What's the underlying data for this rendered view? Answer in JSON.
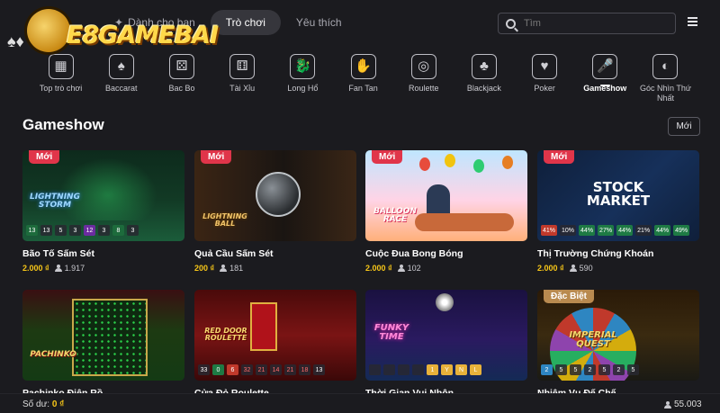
{
  "logo": {
    "text": "E8GAMEBAI",
    "cards": "♠♦"
  },
  "header": {
    "tabs": [
      {
        "label": "Dành cho bạn"
      },
      {
        "label": "Trò chơi"
      },
      {
        "label": "Yêu thích"
      }
    ],
    "search_placeholder": "Tìm"
  },
  "categories": [
    {
      "label": "Top trò chơi",
      "icon": "▦"
    },
    {
      "label": "Baccarat",
      "icon": "♠"
    },
    {
      "label": "Bac Bo",
      "icon": "⚄"
    },
    {
      "label": "Tài Xỉu",
      "icon": "⚅"
    },
    {
      "label": "Long Hổ",
      "icon": "🐉"
    },
    {
      "label": "Fan Tan",
      "icon": "✋"
    },
    {
      "label": "Roulette",
      "icon": "◎"
    },
    {
      "label": "Blackjack",
      "icon": "♣"
    },
    {
      "label": "Poker",
      "icon": "♥"
    },
    {
      "label": "Gameshow",
      "icon": "🎤"
    },
    {
      "label": "Góc Nhìn Thứ Nhất",
      "icon": "◐"
    }
  ],
  "section": {
    "title": "Gameshow",
    "sort_label": "Mới"
  },
  "games": [
    {
      "name": "Bão Tố Sấm Sét",
      "price": "2.000 ₫",
      "players": "1.917",
      "badge": "Mới",
      "thumb_text": "LIGHTNING STORM",
      "chips": [
        "13",
        "13",
        "5",
        "3",
        "12",
        "3",
        "8",
        "3"
      ]
    },
    {
      "name": "Quả Cầu Sấm Sét",
      "price": "200 ₫",
      "players": "181",
      "badge": "Mới",
      "thumb_text": "LIGHTNING BALL",
      "chips": []
    },
    {
      "name": "Cuộc Đua Bong Bóng",
      "price": "2.000 ₫",
      "players": "102",
      "badge": "Mới",
      "thumb_text": "BALLOON RACE",
      "chips": []
    },
    {
      "name": "Thị Trường Chứng Khoán",
      "price": "2.000 ₫",
      "players": "590",
      "badge": "Mới",
      "thumb_text": "STOCK MARKET",
      "chips": [
        "41%",
        "10%",
        "44%",
        "27%",
        "44%",
        "21%",
        "44%",
        "49%"
      ]
    },
    {
      "name": "Pachinko Điên Rồ",
      "price": "",
      "players": "",
      "badge": "",
      "thumb_text": "PACHINKO",
      "chips": []
    },
    {
      "name": "Cửa Đỏ Roulette",
      "price": "",
      "players": "",
      "badge": "",
      "thumb_text": "RED DOOR ROULETTE",
      "chips": [
        "33",
        "0",
        "6",
        "32",
        "21",
        "14",
        "21",
        "18",
        "13"
      ]
    },
    {
      "name": "Thời Gian Vui Nhộn",
      "price": "",
      "players": "",
      "badge": "",
      "thumb_text": "FUNKY TIME",
      "chips": [
        "",
        "",
        "",
        "",
        "1",
        "Y",
        "N",
        "L"
      ]
    },
    {
      "name": "Nhiệm Vụ Đế Chế",
      "price": "",
      "players": "",
      "badge": "Đặc Biệt",
      "thumb_text": "IMPERIAL QUEST",
      "chips": [
        "2",
        "5",
        "5",
        "2",
        "5",
        "2",
        "5"
      ]
    }
  ],
  "footer": {
    "balance_label": "Số dư:",
    "balance_value": "0 ₫",
    "online": "55.003"
  },
  "colors": {
    "accent": "#f5c518",
    "badge": "#e0354a",
    "badge_special": "#b98a4f",
    "bg": "#1b1b1f"
  }
}
